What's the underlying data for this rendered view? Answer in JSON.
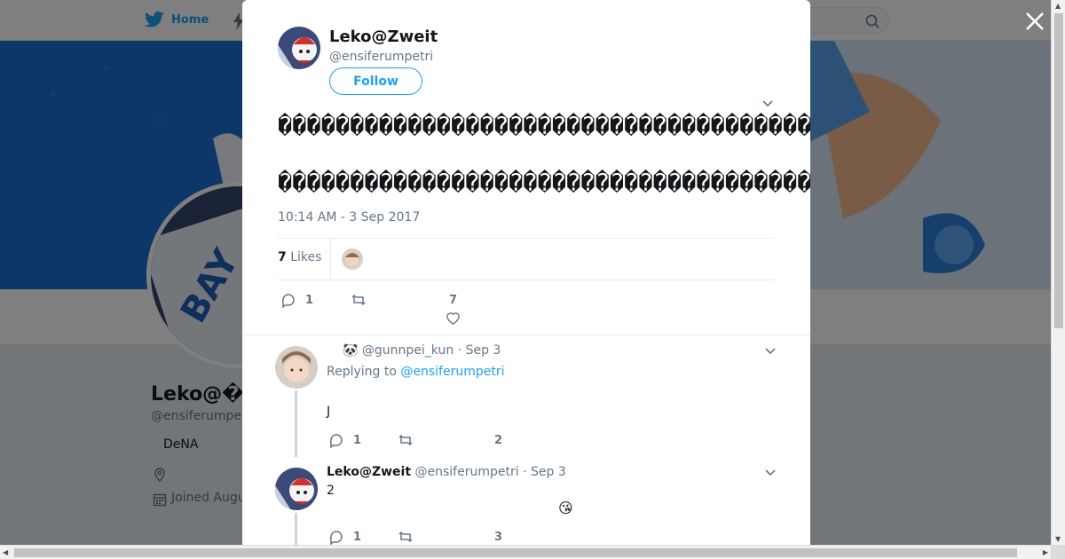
{
  "nav": {
    "home_label": "Home"
  },
  "background_profile": {
    "name": "Leko@��",
    "handle": "@ensiferumpe",
    "bio_item": "DeNA",
    "joined": "Joined Augu"
  },
  "tweet": {
    "author_name": "Leko@Zweit",
    "author_handle": "@ensiferumpetri",
    "follow_label": "Follow",
    "line1": "��������������������������������������������",
    "line2": "�����������������������������������������������(����",
    "timestamp": "10:14 AM - 3 Sep 2017",
    "likes_count": "7",
    "likes_label": "Likes",
    "actions": {
      "replies": "1",
      "retweets": "",
      "likes": "7"
    }
  },
  "replies": [
    {
      "emoji": "🐼",
      "author_name": "",
      "handle": "@gunnpei_kun",
      "date": "· Sep 3",
      "replying_to_label": "Replying to",
      "replying_to_handle": "@ensiferumpetri",
      "text": "J",
      "actions": {
        "replies": "1",
        "retweets": "",
        "likes": "2"
      }
    },
    {
      "author_name": "Leko@Zweit",
      "handle": "@ensiferumpetri",
      "date": "· Sep 3",
      "text": "2",
      "emoji": "😘",
      "actions": {
        "replies": "1",
        "retweets": "",
        "likes": "3"
      }
    }
  ],
  "colors": {
    "accent": "#1da1f2",
    "banner": "#1b74d6",
    "muted": "#657786",
    "text": "#14171a"
  }
}
